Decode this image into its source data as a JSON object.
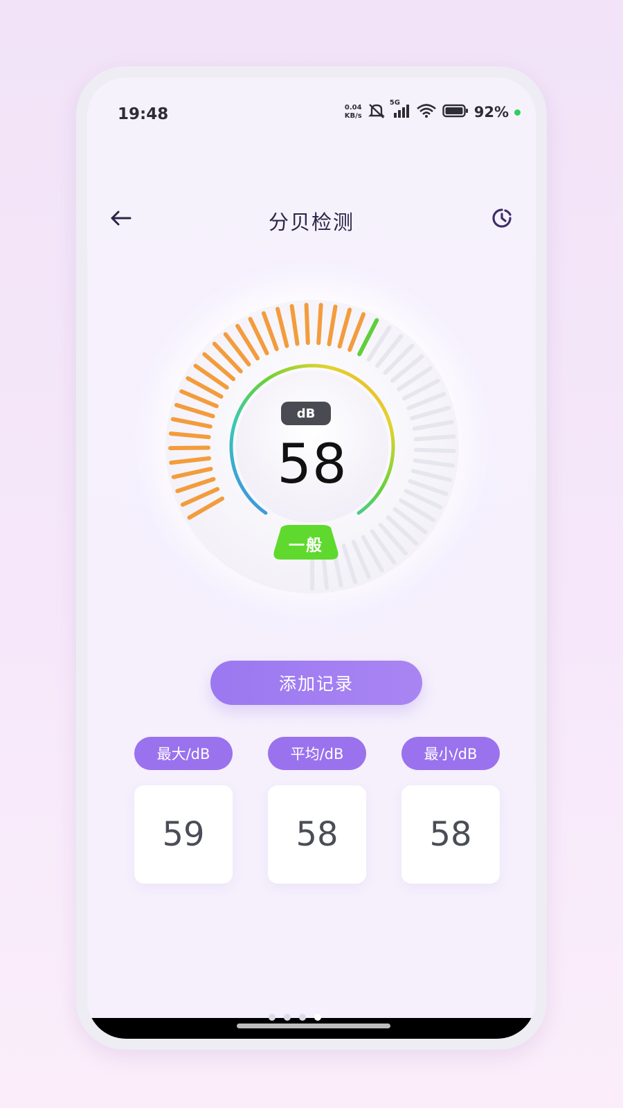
{
  "status_bar": {
    "time": "19:48",
    "net_speed_value": "0.04",
    "net_speed_unit": "KB/s",
    "signal_label": "5G",
    "battery": "92%",
    "icons": [
      "mute-icon",
      "signal-icon",
      "wifi-icon",
      "battery-icon"
    ]
  },
  "header": {
    "title": "分贝检测",
    "back_icon": "arrow-left-icon",
    "history_icon": "history-clock-icon"
  },
  "meter": {
    "unit": "dB",
    "value": "58",
    "level": "一般",
    "value_fraction": 0.48,
    "colors": {
      "active_tick": "#f39c3d",
      "pointer_tick": "#5fcf3a",
      "inactive_tick": "#e6e6ee",
      "level_badge": "#5fd92e"
    }
  },
  "actions": {
    "add_record": "添加记录"
  },
  "stats": [
    {
      "label": "最大/dB",
      "value": "59"
    },
    {
      "label": "平均/dB",
      "value": "58"
    },
    {
      "label": "最小/dB",
      "value": "58"
    }
  ],
  "colors": {
    "accent": "#9a72ee",
    "title": "#2c2446"
  }
}
